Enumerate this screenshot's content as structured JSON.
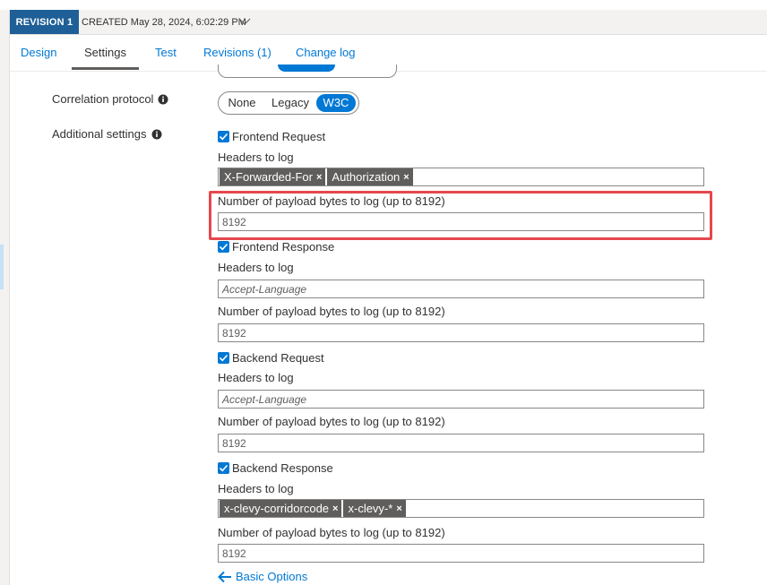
{
  "revision": {
    "badge": "REVISION 1",
    "created": "CREATED May 28, 2024, 6:02:29 PM"
  },
  "tabs": [
    {
      "label": "Design"
    },
    {
      "label": "Settings"
    },
    {
      "label": "Test"
    },
    {
      "label": "Revisions (1)"
    },
    {
      "label": "Change log"
    }
  ],
  "active_tab": "Settings",
  "correlation": {
    "label": "Correlation protocol",
    "options": [
      "None",
      "Legacy",
      "W3C"
    ],
    "selected": "W3C"
  },
  "additional": {
    "label": "Additional settings"
  },
  "sections": [
    {
      "checkbox_label": "Frontend Request",
      "checked": true,
      "headers_label": "Headers to log",
      "headers_tags": [
        "X-Forwarded-For",
        "Authorization"
      ],
      "headers_placeholder": "",
      "payload_label": "Number of payload bytes to log (up to 8192)",
      "payload_value": "8192"
    },
    {
      "checkbox_label": "Frontend Response",
      "checked": true,
      "headers_label": "Headers to log",
      "headers_tags": [],
      "headers_placeholder": "Accept-Language",
      "payload_label": "Number of payload bytes to log (up to 8192)",
      "payload_value": "8192"
    },
    {
      "checkbox_label": "Backend Request",
      "checked": true,
      "headers_label": "Headers to log",
      "headers_tags": [],
      "headers_placeholder": "Accept-Language",
      "payload_label": "Number of payload bytes to log (up to 8192)",
      "payload_value": "8192"
    },
    {
      "checkbox_label": "Backend Response",
      "checked": true,
      "headers_label": "Headers to log",
      "headers_tags": [
        "x-clevy-corridorcode",
        "x-clevy-*"
      ],
      "headers_placeholder": "",
      "payload_label": "Number of payload bytes to log (up to 8192)",
      "payload_value": "8192"
    }
  ],
  "tag_remove_glyph": "×",
  "basic_options_link": "Basic Options",
  "colors": {
    "accent": "#0078d4",
    "revision_badge": "#1f5f97",
    "highlight": "#e5484d",
    "tag_bg": "#605e5c"
  },
  "icons": {
    "info": "info-icon",
    "chevron": "chevron-down-icon",
    "check": "checkmark-icon",
    "back_arrow": "arrow-left-icon"
  }
}
